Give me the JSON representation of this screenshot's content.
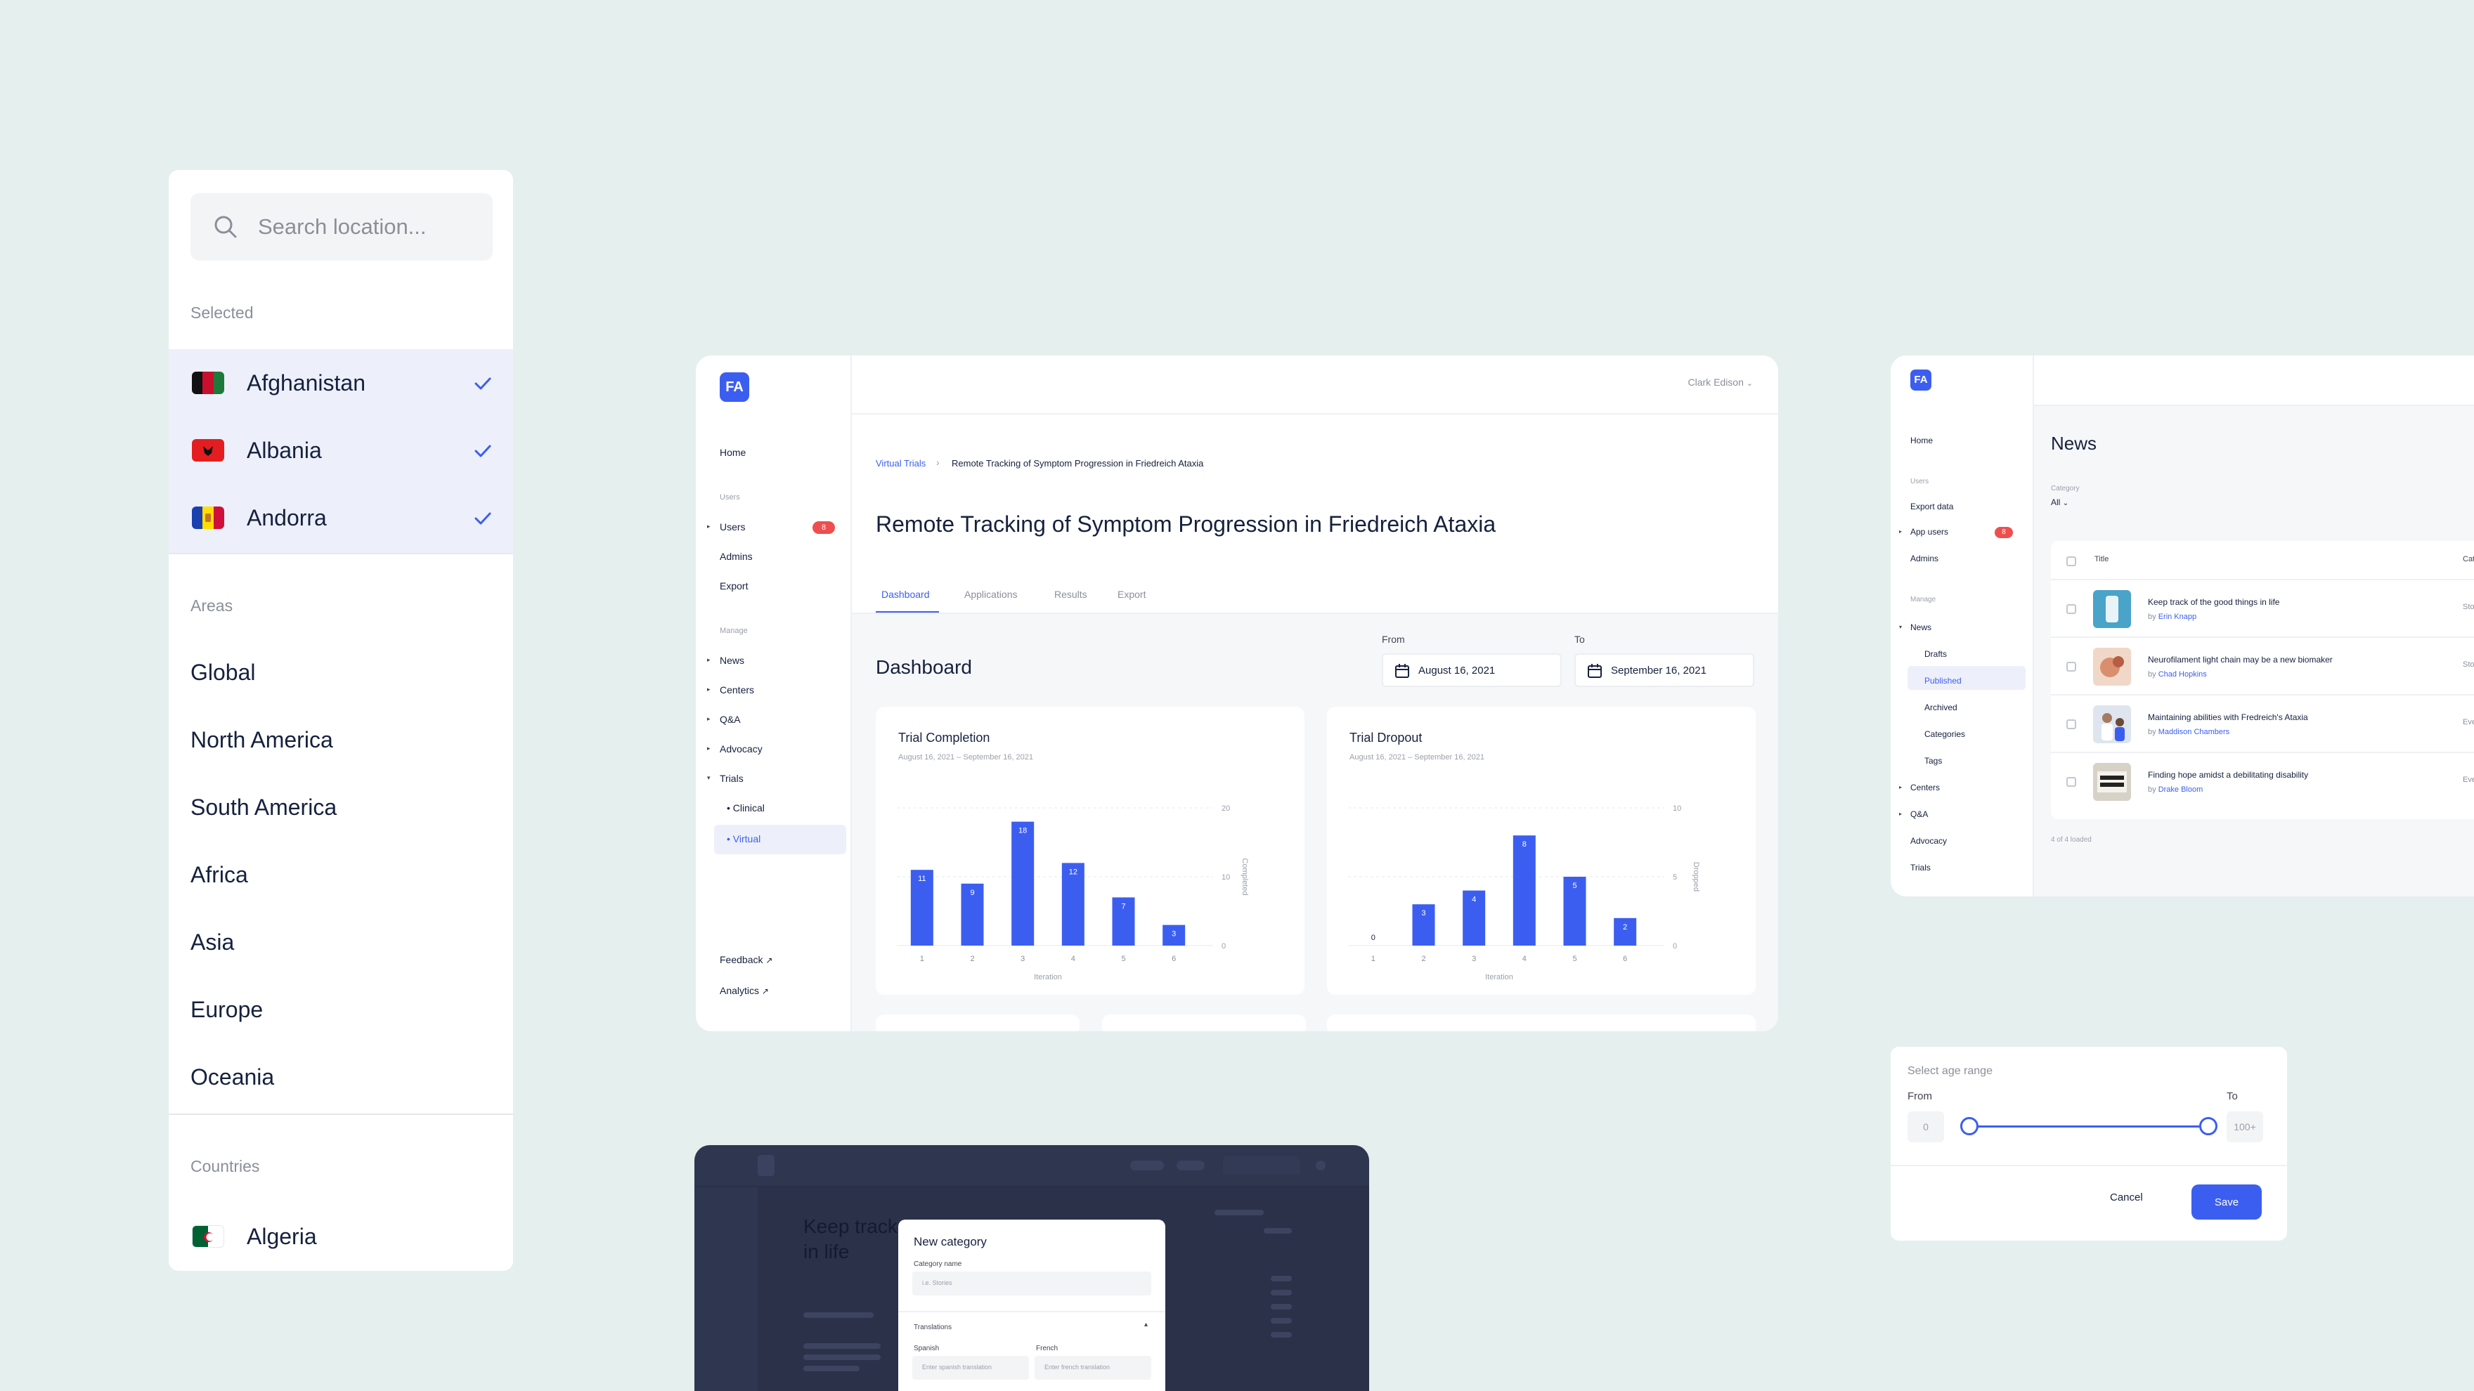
{
  "location": {
    "search_placeholder": "Search location...",
    "selected_label": "Selected",
    "selected": [
      {
        "name": "Afghanistan",
        "flag": "AF"
      },
      {
        "name": "Albania",
        "flag": "AL"
      },
      {
        "name": "Andorra",
        "flag": "AD"
      }
    ],
    "areas_label": "Areas",
    "areas": [
      "Global",
      "North America",
      "South America",
      "Africa",
      "Asia",
      "Europe",
      "Oceania"
    ],
    "countries_label": "Countries",
    "countries": [
      {
        "name": "Algeria",
        "flag": "DZ"
      }
    ]
  },
  "dashboard": {
    "logo": "FA",
    "user": "Clark Edison",
    "nav": {
      "home": "Home",
      "users_heading": "Users",
      "users": "Users",
      "users_badge": "8",
      "admins": "Admins",
      "export": "Export",
      "manage_heading": "Manage",
      "news": "News",
      "centers": "Centers",
      "qa": "Q&A",
      "advocacy": "Advocacy",
      "trials": "Trials",
      "clinical": "Clinical",
      "virtual": "Virtual",
      "feedback": "Feedback",
      "analytics": "Analytics"
    },
    "breadcrumb": {
      "parent": "Virtual Trials",
      "current": "Remote Tracking of Symptom Progression in Friedreich Ataxia"
    },
    "title": "Remote Tracking of Symptom Progression in Friedreich Ataxia",
    "tabs": [
      "Dashboard",
      "Applications",
      "Results",
      "Export"
    ],
    "section_title": "Dashboard",
    "from_label": "From",
    "to_label": "To",
    "from_date": "August 16, 2021",
    "to_date": "September 16, 2021"
  },
  "chart_data": [
    {
      "type": "bar",
      "title": "Trial Completion",
      "subtitle": "August 16, 2021 – September 16, 2021",
      "categories": [
        "1",
        "2",
        "3",
        "4",
        "5",
        "6"
      ],
      "values": [
        11,
        9,
        18,
        12,
        7,
        3
      ],
      "xlabel": "Iteration",
      "ylabel": "Completed",
      "yticks": [
        0,
        10,
        20
      ],
      "ylim": [
        0,
        20
      ],
      "grid": true,
      "color": "#3c5ef0"
    },
    {
      "type": "bar",
      "title": "Trial Dropout",
      "subtitle": "August 16, 2021 – September 16, 2021",
      "categories": [
        "1",
        "2",
        "3",
        "4",
        "5",
        "6"
      ],
      "values": [
        0,
        3,
        4,
        8,
        5,
        2
      ],
      "xlabel": "Iteration",
      "ylabel": "Dropped",
      "yticks": [
        0,
        5,
        10
      ],
      "ylim": [
        0,
        10
      ],
      "grid": true,
      "color": "#3c5ef0"
    }
  ],
  "news": {
    "logo": "FA",
    "nav": {
      "home": "Home",
      "users_heading": "Users",
      "export_data": "Export data",
      "app_users": "App users",
      "app_users_badge": "8",
      "admins": "Admins",
      "manage_heading": "Manage",
      "news": "News",
      "drafts": "Drafts",
      "published": "Published",
      "archived": "Archived",
      "categories": "Categories",
      "tags": "Tags",
      "centers": "Centers",
      "qa": "Q&A",
      "advocacy": "Advocacy",
      "trials": "Trials"
    },
    "title": "News",
    "category_label": "Category",
    "category_value": "All",
    "col_title": "Title",
    "col_category": "Cat",
    "rows": [
      {
        "title": "Keep track of the good things in life",
        "by": "by",
        "author": "Erin Knapp",
        "cat": "Sto"
      },
      {
        "title": "Neurofilament light chain may be a new biomaker",
        "by": "by",
        "author": "Chad Hopkins",
        "cat": "Sto"
      },
      {
        "title": "Maintaining abilities with Fredreich's Ataxia",
        "by": "by",
        "author": "Maddison Chambers",
        "cat": "Eve"
      },
      {
        "title": "Finding hope amidst a debilitating disability",
        "by": "by",
        "author": "Drake Bloom",
        "cat": "Eve"
      }
    ],
    "loaded": "4 of 4 loaded"
  },
  "age": {
    "title": "Select age range",
    "from_label": "From",
    "to_label": "To",
    "from_value": "0",
    "to_value": "100+",
    "range_min": 0,
    "range_max": 1,
    "cancel": "Cancel",
    "save": "Save"
  },
  "editor": {
    "bg_title_1": "Keep track",
    "bg_title_2": "in life",
    "modal_title": "New category",
    "category_name_label": "Category name",
    "category_name_placeholder": "i.e. Stories",
    "translations_label": "Translations",
    "spanish_label": "Spanish",
    "french_label": "French",
    "spanish_placeholder": "Enter spanish translation",
    "french_placeholder": "Enter french translation"
  },
  "colors": {
    "accent": "#3c5ef0",
    "badge": "#f04e4e",
    "background": "#e4efee"
  }
}
